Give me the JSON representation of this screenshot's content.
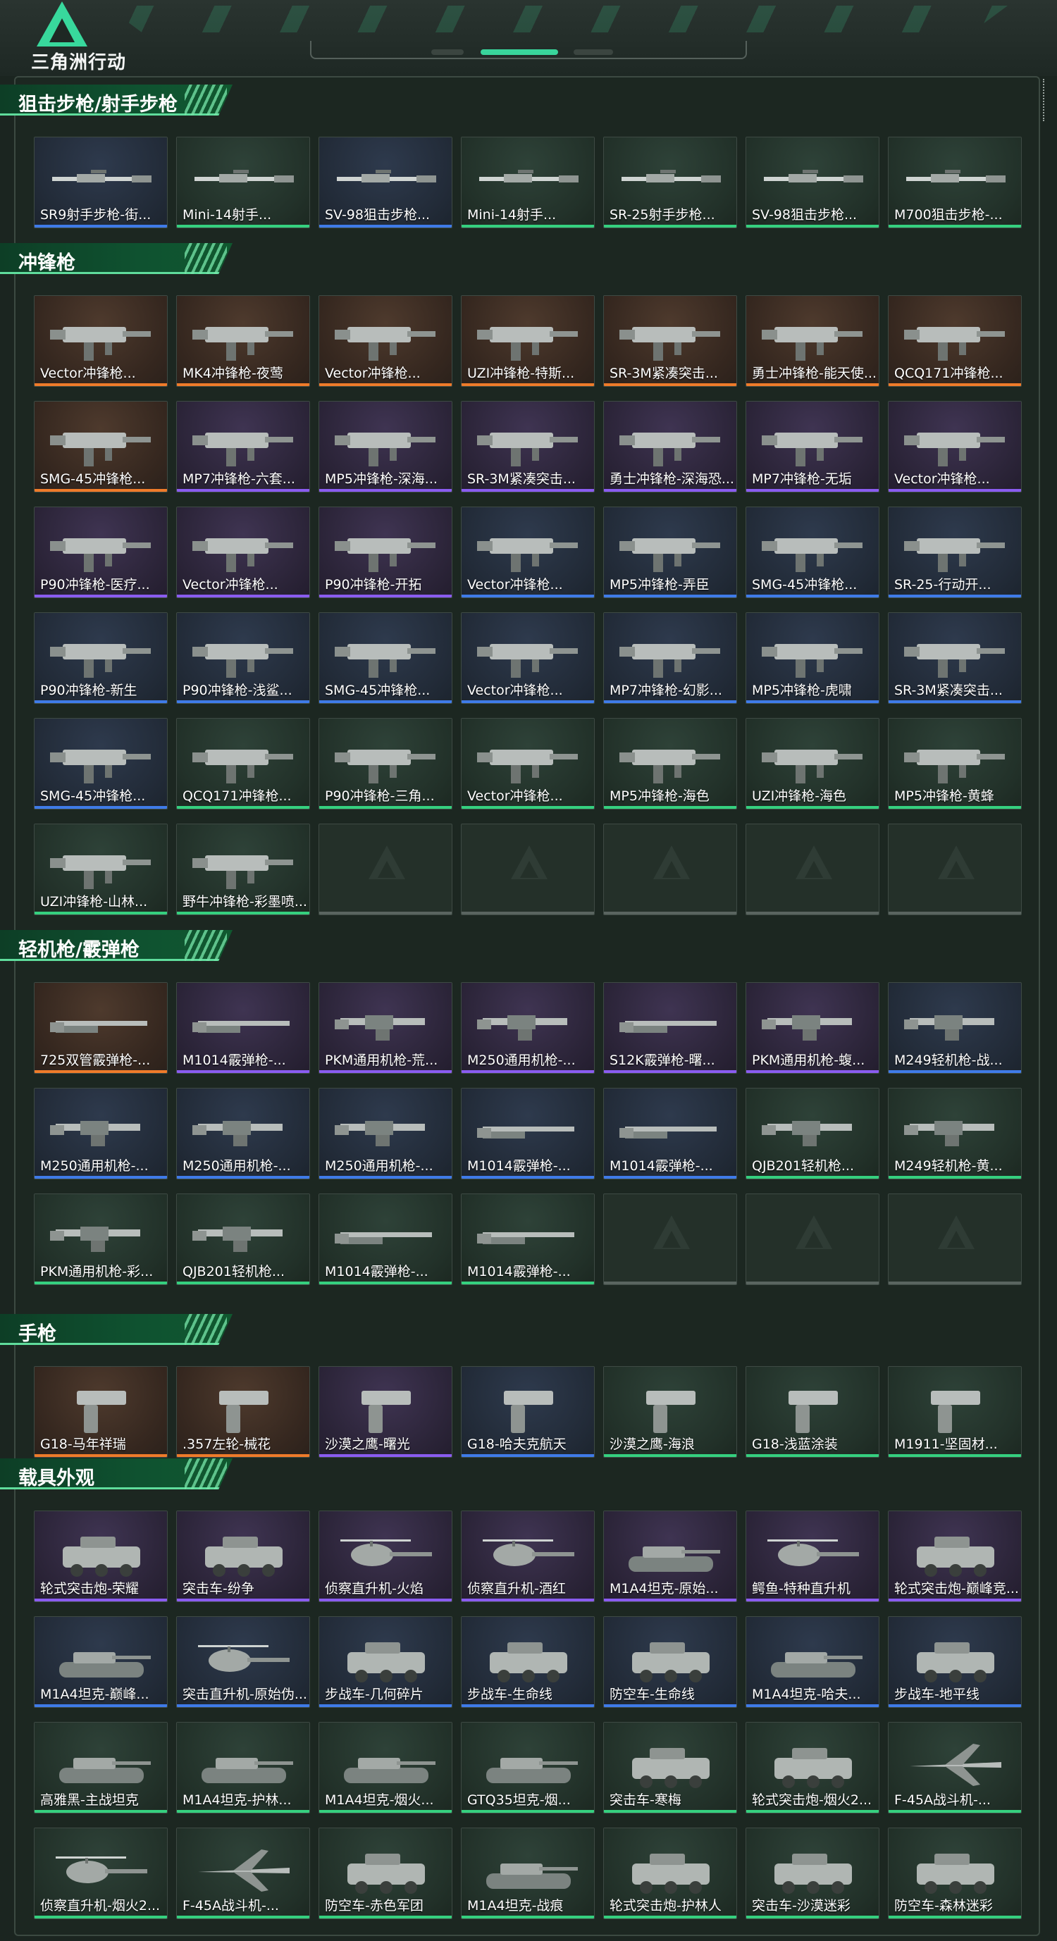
{
  "header": {
    "logo_text": "三角洲行动"
  },
  "colors": {
    "orange": "#ef7b2a",
    "purple": "#8a5cf0",
    "blue": "#3f7be8",
    "green": "#35d07f",
    "accent": "#38d89c"
  },
  "sections": [
    {
      "title": "狙击步枪/射手步枪",
      "rows": [
        [
          {
            "name": "SR9射手步枪-街...",
            "rarity": "blue",
            "icon": "rifle-icon"
          },
          {
            "name": "Mini-14射手...",
            "rarity": "green",
            "icon": "rifle-icon"
          },
          {
            "name": "SV-98狙击步枪...",
            "rarity": "blue",
            "icon": "rifle-icon"
          },
          {
            "name": "Mini-14射手...",
            "rarity": "green",
            "icon": "rifle-icon"
          },
          {
            "name": "SR-25射手步枪...",
            "rarity": "green",
            "icon": "rifle-icon"
          },
          {
            "name": "SV-98狙击步枪...",
            "rarity": "green",
            "icon": "rifle-icon"
          },
          {
            "name": "M700狙击步枪-...",
            "rarity": "green",
            "icon": "rifle-icon"
          }
        ]
      ]
    },
    {
      "title": "冲锋枪",
      "rows": [
        [
          {
            "name": "Vector冲锋枪...",
            "rarity": "orange",
            "icon": "smg-icon"
          },
          {
            "name": "MK4冲锋枪-夜莺",
            "rarity": "orange",
            "icon": "smg-icon"
          },
          {
            "name": "Vector冲锋枪...",
            "rarity": "orange",
            "icon": "smg-icon"
          },
          {
            "name": "UZI冲锋枪-特斯...",
            "rarity": "orange",
            "icon": "smg-icon"
          },
          {
            "name": "SR-3M紧凑突击...",
            "rarity": "orange",
            "icon": "smg-icon"
          },
          {
            "name": "勇士冲锋枪-能天使...",
            "rarity": "orange",
            "icon": "smg-icon"
          },
          {
            "name": "QCQ171冲锋枪...",
            "rarity": "orange",
            "icon": "smg-icon"
          }
        ],
        [
          {
            "name": "SMG-45冲锋枪...",
            "rarity": "orange",
            "icon": "smg-icon"
          },
          {
            "name": "MP7冲锋枪-六套...",
            "rarity": "purple",
            "icon": "smg-icon"
          },
          {
            "name": "MP5冲锋枪-深海...",
            "rarity": "purple",
            "icon": "smg-icon"
          },
          {
            "name": "SR-3M紧凑突击...",
            "rarity": "purple",
            "icon": "smg-icon"
          },
          {
            "name": "勇士冲锋枪-深海恐...",
            "rarity": "purple",
            "icon": "smg-icon"
          },
          {
            "name": "MP7冲锋枪-无垢",
            "rarity": "purple",
            "icon": "smg-icon"
          },
          {
            "name": "Vector冲锋枪...",
            "rarity": "purple",
            "icon": "smg-icon"
          }
        ],
        [
          {
            "name": "P90冲锋枪-医疗...",
            "rarity": "purple",
            "icon": "smg-icon"
          },
          {
            "name": "Vector冲锋枪...",
            "rarity": "purple",
            "icon": "smg-icon"
          },
          {
            "name": "P90冲锋枪-开拓",
            "rarity": "purple",
            "icon": "smg-icon"
          },
          {
            "name": "Vector冲锋枪...",
            "rarity": "blue",
            "icon": "smg-icon"
          },
          {
            "name": "MP5冲锋枪-弄臣",
            "rarity": "blue",
            "icon": "smg-icon"
          },
          {
            "name": "SMG-45冲锋枪...",
            "rarity": "blue",
            "icon": "smg-icon"
          },
          {
            "name": "SR-25-行动开...",
            "rarity": "blue",
            "icon": "smg-icon"
          }
        ],
        [
          {
            "name": "P90冲锋枪-新生",
            "rarity": "blue",
            "icon": "smg-icon"
          },
          {
            "name": "P90冲锋枪-浅鲨...",
            "rarity": "blue",
            "icon": "smg-icon"
          },
          {
            "name": "SMG-45冲锋枪...",
            "rarity": "blue",
            "icon": "smg-icon"
          },
          {
            "name": "Vector冲锋枪...",
            "rarity": "blue",
            "icon": "smg-icon"
          },
          {
            "name": "MP7冲锋枪-幻影...",
            "rarity": "blue",
            "icon": "smg-icon"
          },
          {
            "name": "MP5冲锋枪-虎啸",
            "rarity": "blue",
            "icon": "smg-icon"
          },
          {
            "name": "SR-3M紧凑突击...",
            "rarity": "blue",
            "icon": "smg-icon"
          }
        ],
        [
          {
            "name": "SMG-45冲锋枪...",
            "rarity": "blue",
            "icon": "smg-icon"
          },
          {
            "name": "QCQ171冲锋枪...",
            "rarity": "green",
            "icon": "smg-icon"
          },
          {
            "name": "P90冲锋枪-三角...",
            "rarity": "green",
            "icon": "smg-icon"
          },
          {
            "name": "Vector冲锋枪...",
            "rarity": "green",
            "icon": "smg-icon"
          },
          {
            "name": "MP5冲锋枪-海色",
            "rarity": "green",
            "icon": "smg-icon"
          },
          {
            "name": "UZI冲锋枪-海色",
            "rarity": "green",
            "icon": "smg-icon"
          },
          {
            "name": "MP5冲锋枪-黄蜂",
            "rarity": "green",
            "icon": "smg-icon"
          }
        ],
        [
          {
            "name": "UZI冲锋枪-山林...",
            "rarity": "green",
            "icon": "smg-icon"
          },
          {
            "name": "野牛冲锋枪-彩墨喷...",
            "rarity": "green",
            "icon": "smg-icon"
          },
          {
            "empty": true
          },
          {
            "empty": true
          },
          {
            "empty": true
          },
          {
            "empty": true
          },
          {
            "empty": true
          }
        ]
      ]
    },
    {
      "title": "轻机枪/霰弹枪",
      "rows": [
        [
          {
            "name": "725双管霰弹枪-...",
            "rarity": "orange",
            "icon": "shotgun-icon"
          },
          {
            "name": "M1014霰弹枪-...",
            "rarity": "purple",
            "icon": "shotgun-icon"
          },
          {
            "name": "PKM通用机枪-荒...",
            "rarity": "purple",
            "icon": "lmg-icon"
          },
          {
            "name": "M250通用机枪-...",
            "rarity": "purple",
            "icon": "lmg-icon"
          },
          {
            "name": "S12K霰弹枪-曙...",
            "rarity": "purple",
            "icon": "shotgun-icon"
          },
          {
            "name": "PKM通用机枪-蝮...",
            "rarity": "purple",
            "icon": "lmg-icon"
          },
          {
            "name": "M249轻机枪-战...",
            "rarity": "blue",
            "icon": "lmg-icon"
          }
        ],
        [
          {
            "name": "M250通用机枪-...",
            "rarity": "blue",
            "icon": "lmg-icon"
          },
          {
            "name": "M250通用机枪-...",
            "rarity": "blue",
            "icon": "lmg-icon"
          },
          {
            "name": "M250通用机枪-...",
            "rarity": "blue",
            "icon": "lmg-icon"
          },
          {
            "name": "M1014霰弹枪-...",
            "rarity": "blue",
            "icon": "shotgun-icon"
          },
          {
            "name": "M1014霰弹枪-...",
            "rarity": "blue",
            "icon": "shotgun-icon"
          },
          {
            "name": "QJB201轻机枪...",
            "rarity": "green",
            "icon": "lmg-icon"
          },
          {
            "name": "M249轻机枪-黄...",
            "rarity": "green",
            "icon": "lmg-icon"
          }
        ],
        [
          {
            "name": "PKM通用机枪-彩...",
            "rarity": "green",
            "icon": "lmg-icon"
          },
          {
            "name": "QJB201轻机枪...",
            "rarity": "green",
            "icon": "lmg-icon"
          },
          {
            "name": "M1014霰弹枪-...",
            "rarity": "green",
            "icon": "shotgun-icon"
          },
          {
            "name": "M1014霰弹枪-...",
            "rarity": "green",
            "icon": "shotgun-icon"
          },
          {
            "empty": true
          },
          {
            "empty": true
          },
          {
            "empty": true
          }
        ]
      ]
    },
    {
      "title": "手枪",
      "rows": [
        [
          {
            "name": "G18-马年祥瑞",
            "rarity": "orange",
            "icon": "pistol-icon"
          },
          {
            "name": ".357左轮-械花",
            "rarity": "orange",
            "icon": "pistol-icon"
          },
          {
            "name": "沙漠之鹰-曙光",
            "rarity": "purple",
            "icon": "pistol-icon"
          },
          {
            "name": "G18-哈夫克航天",
            "rarity": "blue",
            "icon": "pistol-icon"
          },
          {
            "name": "沙漠之鹰-海浪",
            "rarity": "green",
            "icon": "pistol-icon"
          },
          {
            "name": "G18-浅蓝涂装",
            "rarity": "green",
            "icon": "pistol-icon"
          },
          {
            "name": "M1911-坚固材...",
            "rarity": "green",
            "icon": "pistol-icon"
          }
        ]
      ]
    },
    {
      "title": "载具外观",
      "rows": [
        [
          {
            "name": "轮式突击炮-荣耀",
            "rarity": "purple",
            "icon": "vehicle-icon"
          },
          {
            "name": "突击车-纷争",
            "rarity": "purple",
            "icon": "vehicle-icon"
          },
          {
            "name": "侦察直升机-火焰",
            "rarity": "purple",
            "icon": "helicopter-icon"
          },
          {
            "name": "侦察直升机-酒红",
            "rarity": "purple",
            "icon": "helicopter-icon"
          },
          {
            "name": "M1A4坦克-原始...",
            "rarity": "purple",
            "icon": "tank-icon"
          },
          {
            "name": "鳄鱼-特种直升机",
            "rarity": "purple",
            "icon": "helicopter-icon"
          },
          {
            "name": "轮式突击炮-巅峰竞...",
            "rarity": "purple",
            "icon": "vehicle-icon"
          }
        ],
        [
          {
            "name": "M1A4坦克-巅峰...",
            "rarity": "blue",
            "icon": "tank-icon"
          },
          {
            "name": "突击直升机-原始伪...",
            "rarity": "blue",
            "icon": "helicopter-icon"
          },
          {
            "name": "步战车-几何碎片",
            "rarity": "blue",
            "icon": "vehicle-icon"
          },
          {
            "name": "步战车-生命线",
            "rarity": "blue",
            "icon": "vehicle-icon"
          },
          {
            "name": "防空车-生命线",
            "rarity": "blue",
            "icon": "vehicle-icon"
          },
          {
            "name": "M1A4坦克-哈夫...",
            "rarity": "blue",
            "icon": "tank-icon"
          },
          {
            "name": "步战车-地平线",
            "rarity": "blue",
            "icon": "vehicle-icon"
          }
        ],
        [
          {
            "name": "高雅黑-主战坦克",
            "rarity": "green",
            "icon": "tank-icon"
          },
          {
            "name": "M1A4坦克-护林...",
            "rarity": "green",
            "icon": "tank-icon"
          },
          {
            "name": "M1A4坦克-烟火...",
            "rarity": "green",
            "icon": "tank-icon"
          },
          {
            "name": "GTQ35坦克-烟...",
            "rarity": "green",
            "icon": "tank-icon"
          },
          {
            "name": "突击车-寒梅",
            "rarity": "green",
            "icon": "vehicle-icon"
          },
          {
            "name": "轮式突击炮-烟火2...",
            "rarity": "green",
            "icon": "vehicle-icon"
          },
          {
            "name": "F-45A战斗机-...",
            "rarity": "green",
            "icon": "jet-icon"
          }
        ],
        [
          {
            "name": "侦察直升机-烟火2...",
            "rarity": "green",
            "icon": "helicopter-icon"
          },
          {
            "name": "F-45A战斗机-...",
            "rarity": "green",
            "icon": "jet-icon"
          },
          {
            "name": "防空车-赤色军团",
            "rarity": "green",
            "icon": "vehicle-icon"
          },
          {
            "name": "M1A4坦克-战痕",
            "rarity": "green",
            "icon": "tank-icon"
          },
          {
            "name": "轮式突击炮-护林人",
            "rarity": "green",
            "icon": "vehicle-icon"
          },
          {
            "name": "突击车-沙漠迷彩",
            "rarity": "green",
            "icon": "vehicle-icon"
          },
          {
            "name": "防空车-森林迷彩",
            "rarity": "green",
            "icon": "vehicle-icon"
          }
        ]
      ]
    }
  ]
}
